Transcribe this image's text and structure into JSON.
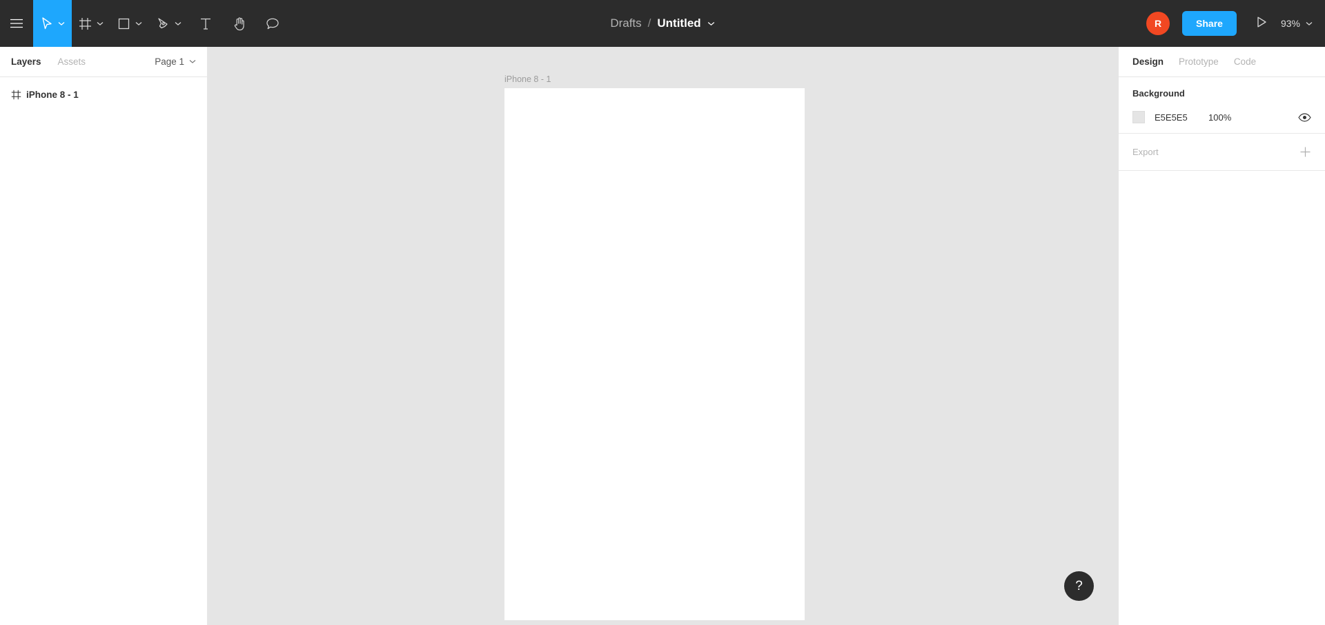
{
  "toolbar": {
    "menu_icon": "hamburger-menu-icon",
    "tools": [
      {
        "id": "move",
        "icon": "cursor-arrow-icon",
        "label": "Move",
        "has_chevron": true,
        "active": true
      },
      {
        "id": "frame",
        "icon": "frame-icon",
        "label": "Frame",
        "has_chevron": true,
        "active": false
      },
      {
        "id": "shape",
        "icon": "rectangle-icon",
        "label": "Shape",
        "has_chevron": true,
        "active": false
      },
      {
        "id": "pen",
        "icon": "pen-icon",
        "label": "Pen",
        "has_chevron": true,
        "active": false
      },
      {
        "id": "text",
        "icon": "text-icon",
        "label": "Text",
        "has_chevron": false,
        "active": false
      },
      {
        "id": "hand",
        "icon": "hand-icon",
        "label": "Hand",
        "has_chevron": false,
        "active": false
      },
      {
        "id": "comment",
        "icon": "comment-bubble-icon",
        "label": "Comment",
        "has_chevron": false,
        "active": false
      }
    ],
    "breadcrumb_parent": "Drafts",
    "breadcrumb_separator": "/",
    "file_name": "Untitled",
    "avatar_initial": "R",
    "avatar_color": "#F24822",
    "share_label": "Share",
    "accent_color": "#1EA7FD",
    "present_icon": "play-triangle-icon",
    "zoom_level": "93%"
  },
  "left_panel": {
    "tabs": [
      {
        "label": "Layers",
        "active": true
      },
      {
        "label": "Assets",
        "active": false
      }
    ],
    "page_selector": "Page 1",
    "layers": [
      {
        "icon": "frame-icon",
        "name": "iPhone 8 - 1"
      }
    ]
  },
  "canvas": {
    "frame_label": "iPhone 8 - 1",
    "artboard_fill": "#FFFFFF",
    "canvas_fill": "#E5E5E5",
    "help_label": "?"
  },
  "right_panel": {
    "tabs": [
      {
        "label": "Design",
        "active": true
      },
      {
        "label": "Prototype",
        "active": false
      },
      {
        "label": "Code",
        "active": false
      }
    ],
    "background": {
      "title": "Background",
      "color_hex": "E5E5E5",
      "swatch_color": "#E5E5E5",
      "opacity": "100%",
      "visibility_icon": "eye-icon"
    },
    "export": {
      "title": "Export",
      "add_icon": "plus-icon"
    }
  }
}
